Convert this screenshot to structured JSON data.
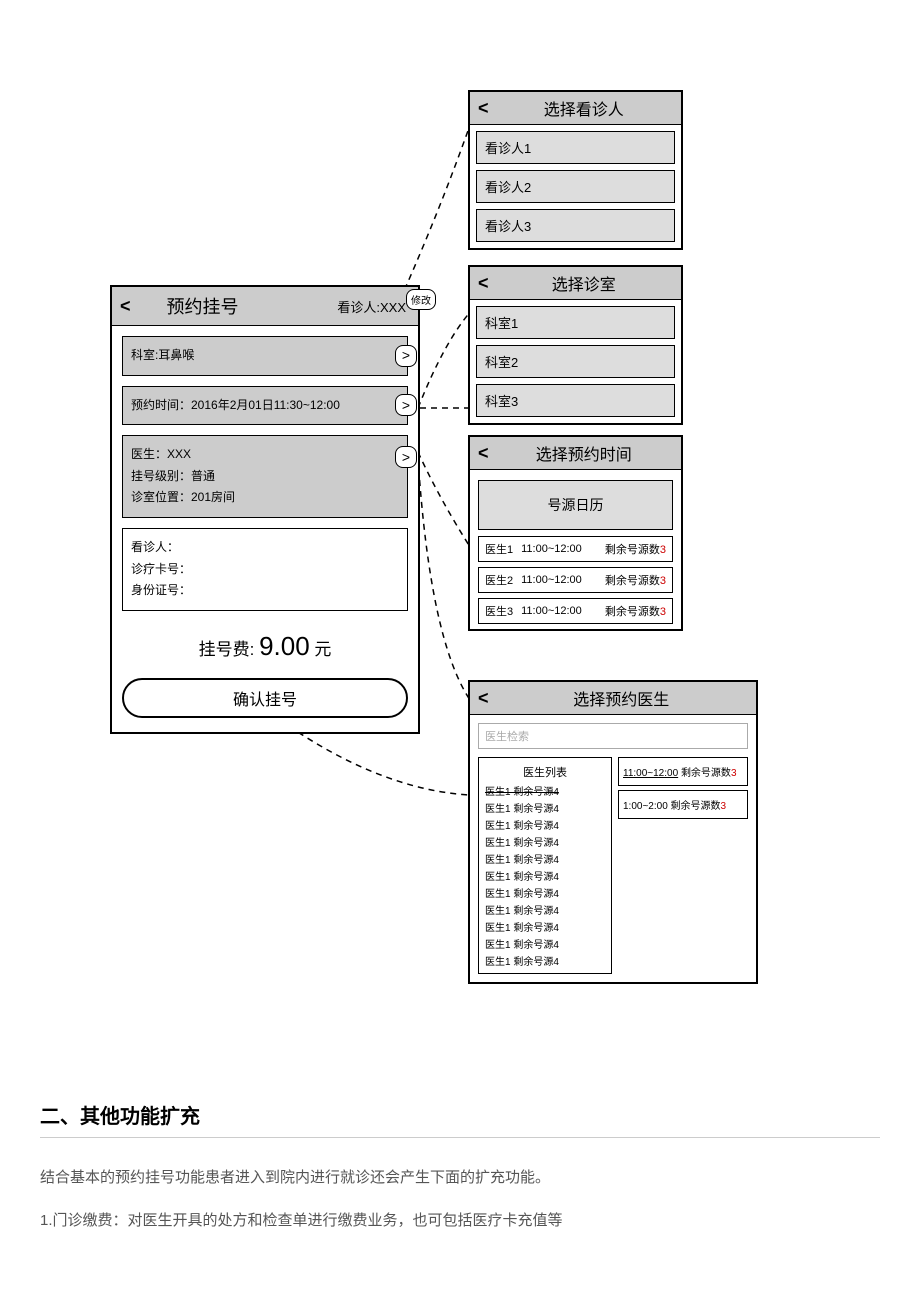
{
  "main": {
    "title": "预约挂号",
    "patient_label": "看诊人:XXX",
    "modify": "修改",
    "dept": "科室:耳鼻喉",
    "time": "预约时间：2016年2月01日11:30~12:00",
    "doctor_line": "医生：XXX",
    "level_line": "挂号级别：普通",
    "room_line": "诊室位置：201房间",
    "patient_info_l1": "看诊人：",
    "patient_info_l2": "诊疗卡号：",
    "patient_info_l3": "身份证号：",
    "fee_label": "挂号费:",
    "fee_amount": "9.00",
    "fee_unit": "元",
    "confirm": "确认挂号"
  },
  "sel_patient": {
    "title": "选择看诊人",
    "items": [
      "看诊人1",
      "看诊人2",
      "看诊人3"
    ]
  },
  "sel_dept": {
    "title": "选择诊室",
    "items": [
      "科室1",
      "科室2",
      "科室3"
    ]
  },
  "sel_time": {
    "title": "选择预约时间",
    "calendar": "号源日历",
    "slots": [
      {
        "doc": "医生1",
        "time": "11:00~12:00",
        "remain_label": "剩余号源数",
        "remain": "3"
      },
      {
        "doc": "医生2",
        "time": "11:00~12:00",
        "remain_label": "剩余号源数",
        "remain": "3"
      },
      {
        "doc": "医生3",
        "time": "11:00~12:00",
        "remain_label": "剩余号源数",
        "remain": "3"
      }
    ]
  },
  "sel_doctor": {
    "title": "选择预约医生",
    "search_placeholder": "医生检索",
    "list_title": "医生列表",
    "list_first": "医生1 剩余号源4",
    "list_items": [
      "医生1 剩余号源4",
      "医生1 剩余号源4",
      "医生1 剩余号源4",
      "医生1 剩余号源4",
      "医生1 剩余号源4",
      "医生1 剩余号源4",
      "医生1 剩余号源4",
      "医生1 剩余号源4",
      "医生1 剩余号源4",
      "医生1 剩余号源4"
    ],
    "right": [
      {
        "time": "11:00~12:00",
        "remain_label": "剩余号源数",
        "remain": "3"
      },
      {
        "time": "1:00~2:00",
        "remain_label": "剩余号源数",
        "remain": "3"
      }
    ]
  },
  "article": {
    "heading": "二、其他功能扩充",
    "intro": "结合基本的预约挂号功能患者进入到院内进行就诊还会产生下面的扩充功能。",
    "item1": "1.门诊缴费：对医生开具的处方和检查单进行缴费业务，也可包括医疗卡充值等"
  }
}
